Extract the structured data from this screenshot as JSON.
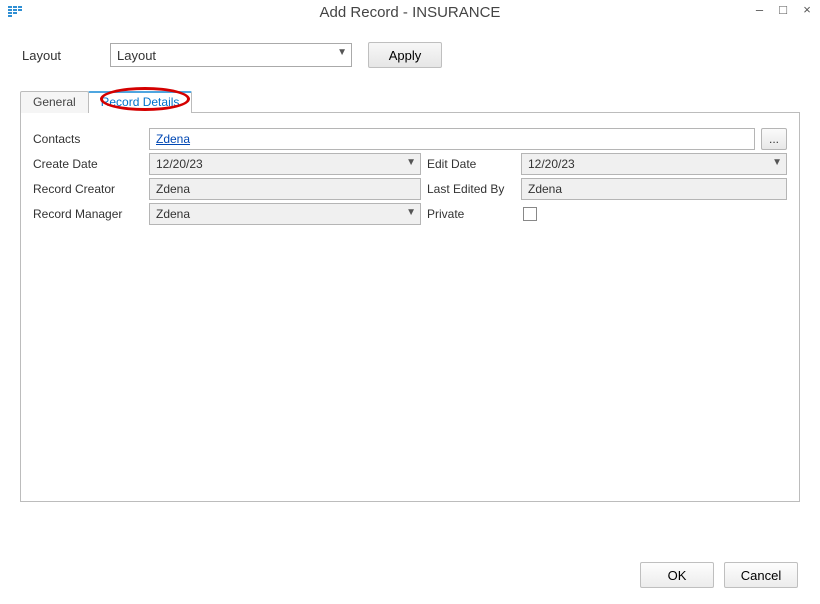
{
  "window": {
    "title": "Add Record - INSURANCE",
    "min": "—",
    "max": "□",
    "close": "×"
  },
  "layoutRow": {
    "label": "Layout",
    "value": "Layout",
    "apply": "Apply"
  },
  "tabs": {
    "general": "General",
    "details": "Record Details"
  },
  "fields": {
    "contactsLabel": "Contacts",
    "contactsValue": "Zdena",
    "ellipsis": "...",
    "createDateLabel": "Create Date",
    "createDateValue": "12/20/23",
    "editDateLabel": "Edit Date",
    "editDateValue": "12/20/23",
    "recordCreatorLabel": "Record Creator",
    "recordCreatorValue": "Zdena",
    "lastEditedByLabel": "Last Edited By",
    "lastEditedByValue": "Zdena",
    "recordManagerLabel": "Record Manager",
    "recordManagerValue": "Zdena",
    "privateLabel": "Private"
  },
  "footer": {
    "ok": "OK",
    "cancel": "Cancel"
  }
}
